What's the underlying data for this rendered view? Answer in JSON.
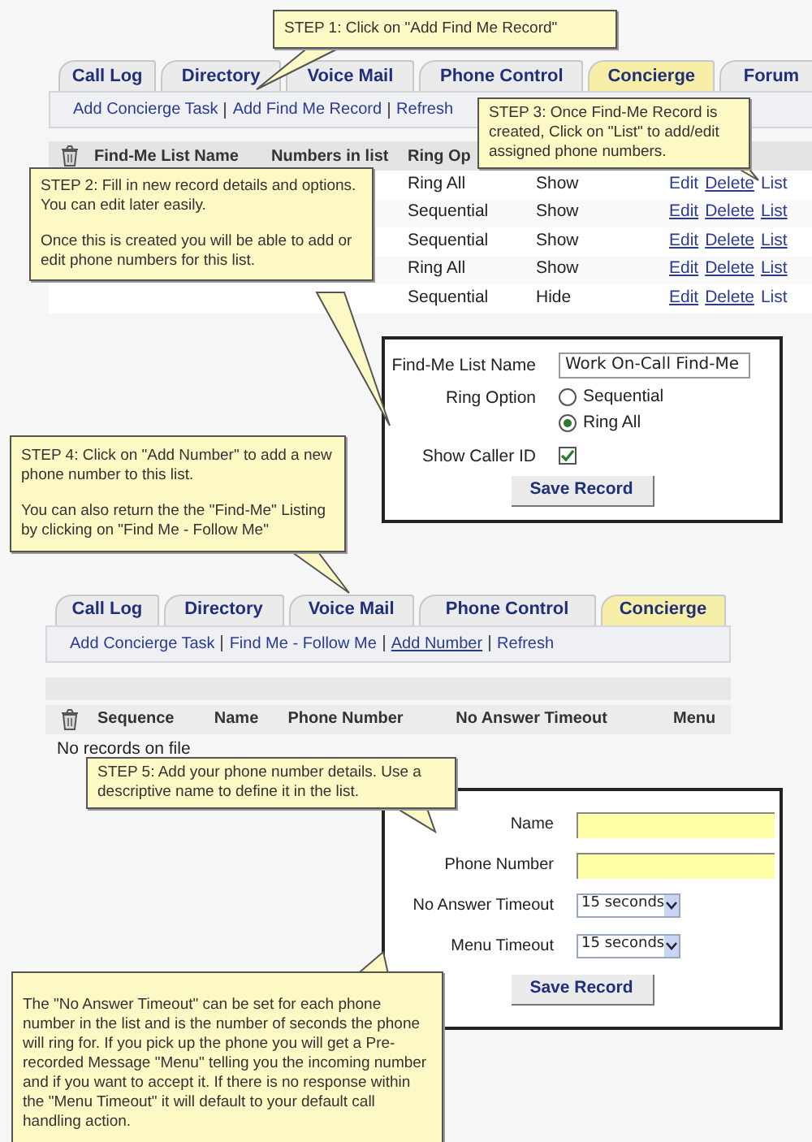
{
  "panel_1": {
    "tabs": [
      {
        "label": "Call Log",
        "selected": false
      },
      {
        "label": "Directory",
        "selected": false
      },
      {
        "label": "Voice Mail",
        "selected": false
      },
      {
        "label": "Phone Control",
        "selected": false
      },
      {
        "label": "Concierge",
        "selected": true
      },
      {
        "label": "Forum",
        "selected": false
      }
    ],
    "subnav": [
      {
        "label": "Add Concierge Task",
        "underlined": false
      },
      {
        "label": "Add Find Me Record",
        "underlined": false
      },
      {
        "label": "Refresh",
        "underlined": false
      }
    ],
    "table": {
      "columns": [
        "Find-Me List Name",
        "Numbers in list",
        "Ring Op"
      ],
      "rows": [
        {
          "ring_option": "Ring All",
          "caller_id": "Show",
          "actions": [
            {
              "label": "Edit",
              "underlined": false
            },
            {
              "label": "Delete",
              "underlined": true
            },
            {
              "label": "List",
              "underlined": false
            }
          ]
        },
        {
          "ring_option": "Sequential",
          "caller_id": "Show",
          "actions": [
            {
              "label": "Edit",
              "underlined": true
            },
            {
              "label": "Delete",
              "underlined": true
            },
            {
              "label": "List",
              "underlined": true
            }
          ]
        },
        {
          "ring_option": "Sequential",
          "caller_id": "Show",
          "actions": [
            {
              "label": "Edit",
              "underlined": true
            },
            {
              "label": "Delete",
              "underlined": true
            },
            {
              "label": "List",
              "underlined": true
            }
          ]
        },
        {
          "ring_option": "Ring All",
          "caller_id": "Show",
          "actions": [
            {
              "label": "Edit",
              "underlined": true
            },
            {
              "label": "Delete",
              "underlined": true
            },
            {
              "label": "List",
              "underlined": true
            }
          ]
        },
        {
          "ring_option": "Sequential",
          "caller_id": "Hide",
          "actions": [
            {
              "label": "Edit",
              "underlined": true
            },
            {
              "label": "Delete",
              "underlined": true
            },
            {
              "label": "List",
              "underlined": false
            }
          ]
        }
      ]
    }
  },
  "form_1": {
    "fields": [
      {
        "kind": "text",
        "label": "Find-Me List Name",
        "value": "Work On-Call Find-Me"
      },
      {
        "kind": "radio",
        "label": "Ring Option",
        "options": [
          {
            "label": "Sequential",
            "selected": false
          },
          {
            "label": "Ring All",
            "selected": true
          }
        ]
      },
      {
        "kind": "checkbox",
        "label": "Show Caller ID",
        "checked": true
      }
    ],
    "button": "Save Record"
  },
  "panel_2": {
    "tabs": [
      {
        "label": "Call Log",
        "selected": false
      },
      {
        "label": "Directory",
        "selected": false
      },
      {
        "label": "Voice Mail",
        "selected": false
      },
      {
        "label": "Phone Control",
        "selected": false
      },
      {
        "label": "Concierge",
        "selected": true
      }
    ],
    "subnav": [
      {
        "label": "Add Concierge Task",
        "underlined": false
      },
      {
        "label": "Find Me - Follow Me",
        "underlined": false
      },
      {
        "label": "Add Number",
        "underlined": true
      },
      {
        "label": "Refresh",
        "underlined": false
      }
    ],
    "table": {
      "columns": [
        "Sequence",
        "Name",
        "Phone Number",
        "No Answer Timeout",
        "Menu"
      ],
      "empty_message": "No records on file"
    }
  },
  "form_2": {
    "fields": [
      {
        "kind": "text",
        "label": "Name"
      },
      {
        "kind": "text",
        "label": "Phone Number"
      },
      {
        "kind": "select",
        "label": "No Answer Timeout",
        "value": "15 seconds"
      },
      {
        "kind": "select",
        "label": "Menu Timeout",
        "value": "15 seconds"
      }
    ],
    "button": "Save Record"
  },
  "callouts": [
    {
      "paragraphs": [
        "STEP 1: Click on \"Add Find Me Record\""
      ]
    },
    {
      "paragraphs": [
        "STEP 3: Once Find-Me Record is created, Click on \"List\" to add/edit assigned phone numbers."
      ]
    },
    {
      "paragraphs": [
        "STEP 2: Fill in new record details and options. You can edit later easily.",
        "Once this is created you will be able to add or edit phone numbers for this list."
      ]
    },
    {
      "paragraphs": [
        "STEP 4: Click on \"Add Number\" to add a new phone number to this list.",
        "You can also return the the \"Find-Me\" Listing by clicking on \"Find Me - Follow Me\""
      ]
    },
    {
      "paragraphs": [
        "STEP 5: Add your phone number details. Use a descriptive name to define it in the list."
      ]
    },
    {
      "paragraphs": [
        "The \"No Answer Timeout\" can be set for each phone number in the list and is the number of seconds the phone will ring for. If you pick up the phone you will get a Pre-recorded Message \"Menu\" telling you the incoming number and if you want to accept it. If there is no response within the \"Menu Timeout\" it will default to your default call handling action."
      ]
    }
  ]
}
